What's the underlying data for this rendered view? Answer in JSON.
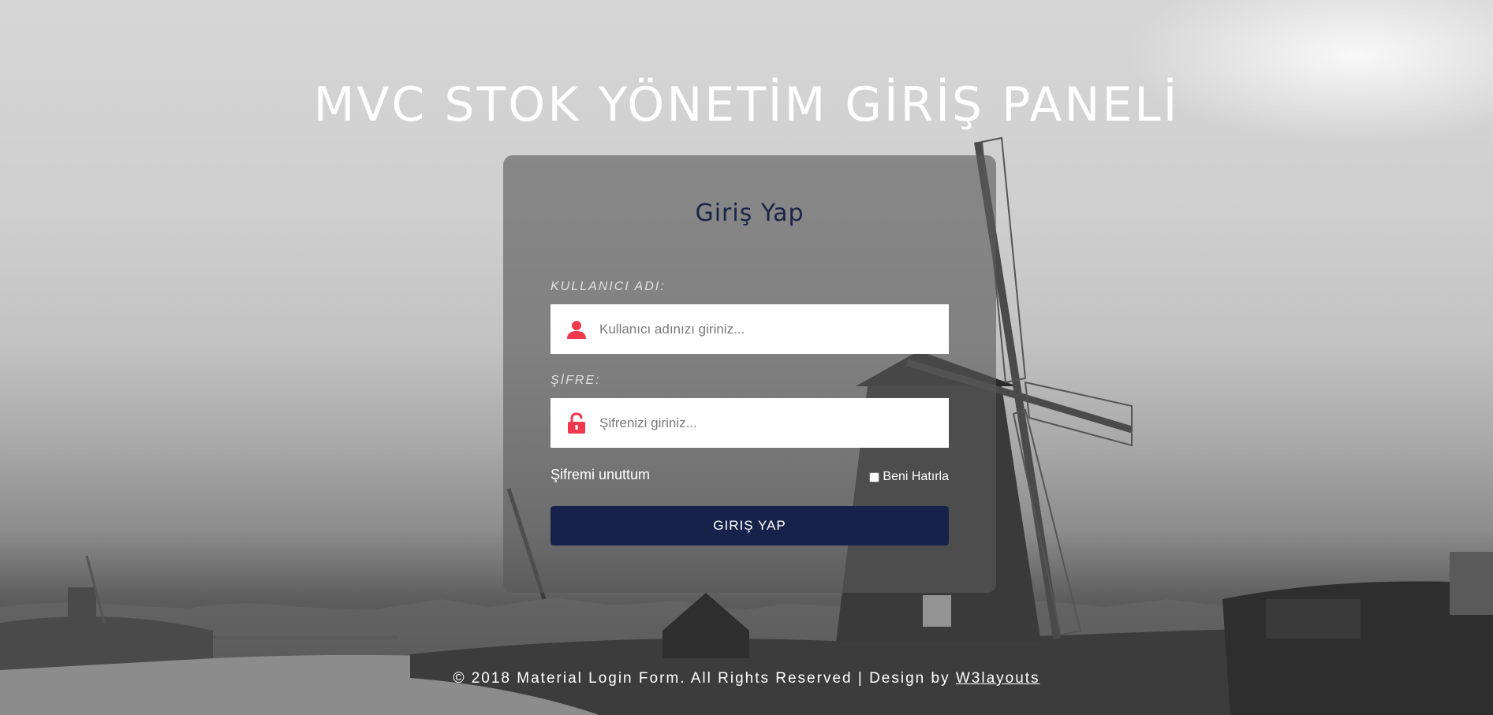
{
  "header": {
    "title": "MVC STOK YÖNETİM GİRİŞ PANELİ"
  },
  "login_form": {
    "title": "Giriş Yap",
    "username": {
      "label": "KULLANICI ADI:",
      "placeholder": "Kullanıcı adınızı giriniz...",
      "value": "",
      "icon": "user-icon"
    },
    "password": {
      "label": "ŞİFRE:",
      "placeholder": "Şifrenizi giriniz...",
      "value": "",
      "icon": "unlock-icon"
    },
    "forgot_password": "Şifremi unuttum",
    "remember_me": {
      "label": "Beni Hatırla",
      "checked": false
    },
    "submit_label": "GIRIŞ YAP"
  },
  "footer": {
    "text": "© 2018 Material Login Form. All Rights Reserved | Design by ",
    "link_text": "W3layouts"
  },
  "colors": {
    "accent_icon": "#f0394f",
    "button": "#17224a",
    "title": "#1a2447"
  }
}
